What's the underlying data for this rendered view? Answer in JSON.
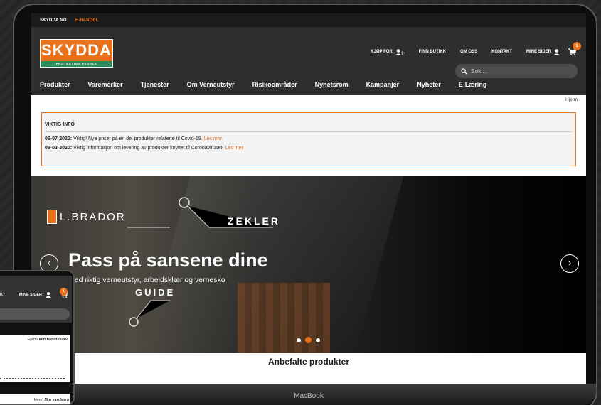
{
  "topbar": {
    "site": "SKYDDA.NO",
    "shop": "E-HANDEL"
  },
  "logo": {
    "word": "SKYDDA",
    "tagline": "PROTECTING PEOPLE"
  },
  "utility": {
    "buy_for": "KJØP FOR",
    "find_store": "FINN BUTIKK",
    "about": "OM OSS",
    "contact": "KONTAKT",
    "my_pages": "MINE SIDER",
    "cart_count": "1"
  },
  "search": {
    "placeholder": "Søk ..."
  },
  "nav": [
    "Produkter",
    "Varemerker",
    "Tjenester",
    "Om Verneutstyr",
    "Risikoområder",
    "Nyhetsrom",
    "Kampanjer",
    "Nyheter",
    "E-Læring"
  ],
  "breadcrumb": "Hjem\\",
  "info": {
    "heading": "VIKTIG INFO",
    "rows": [
      {
        "date": "06-07-2020:",
        "text": " Viktig! Nye priser på en del produkter relaterte til Covid-19. ",
        "link": "Les mer."
      },
      {
        "date": "09-03-2020:",
        "text": " Viktig informasjon om levering av produkter knyttet til Coronaviruset- ",
        "link": "Les mer"
      }
    ]
  },
  "hero": {
    "brands": {
      "lbrador": "L.BRADOR",
      "zekler": "ZEKLER",
      "guide": "GUIDE"
    },
    "title": "Pass på sansene dine",
    "subtitle": "med riktig verneutstyr, arbeidsklær og vernesko",
    "prev": "‹",
    "next": "›"
  },
  "featured": "Anbefalte produkter",
  "bezel": "MacBook",
  "phone": {
    "menu_contact": "KT",
    "menu_my_pages": "MINE SIDER",
    "cart_count": "1",
    "crumb_top_prefix": "Hjem\\ ",
    "crumb_top_bold": "Min handlekurv",
    "crumb_bottom_prefix": "Hem\\ ",
    "crumb_bottom_bold": "Min varukorg"
  },
  "colors": {
    "accent": "#e8731c",
    "header": "#2e2e2e",
    "topbar": "#1b1b1b",
    "logo_tag": "#2a8c5a"
  }
}
